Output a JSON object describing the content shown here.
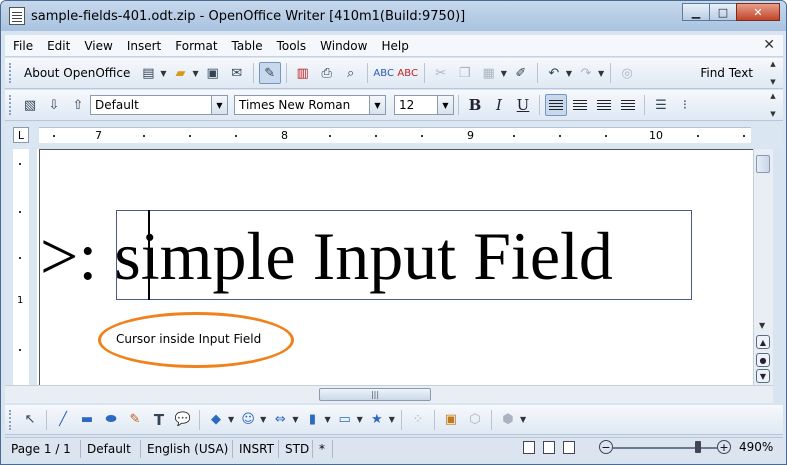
{
  "window": {
    "title": "sample-fields-401.odt.zip - OpenOffice Writer [410m1(Build:9750)]",
    "minimize_label": "▁",
    "maximize_label": "□",
    "close_label": "✕"
  },
  "menu": {
    "items": [
      "File",
      "Edit",
      "View",
      "Insert",
      "Format",
      "Table",
      "Tools",
      "Window",
      "Help"
    ],
    "close_doc": "✕"
  },
  "standard_toolbar": {
    "about_label": "About OpenOffice",
    "find_text_label": "Find Text"
  },
  "formatting_toolbar": {
    "paragraph_style": "Default",
    "font_name": "Times New Roman",
    "font_size": "12",
    "bold_label": "B",
    "italic_label": "I",
    "underline_label": "U"
  },
  "ruler": {
    "corner_label": "L",
    "numbers": [
      "7",
      "8",
      "9",
      "10"
    ]
  },
  "vertical_ruler": {
    "number": "1"
  },
  "document": {
    "prefix_text": ">: ",
    "field_text": "simple Input Field"
  },
  "annotation": {
    "label": "Cursor inside Input Field",
    "color": "#f0821e"
  },
  "statusbar": {
    "page": "Page 1 / 1",
    "style": "Default",
    "language": "English (USA)",
    "insert_mode": "INSRT",
    "selection_mode": "STD",
    "modified": "*",
    "zoom": "490%"
  }
}
